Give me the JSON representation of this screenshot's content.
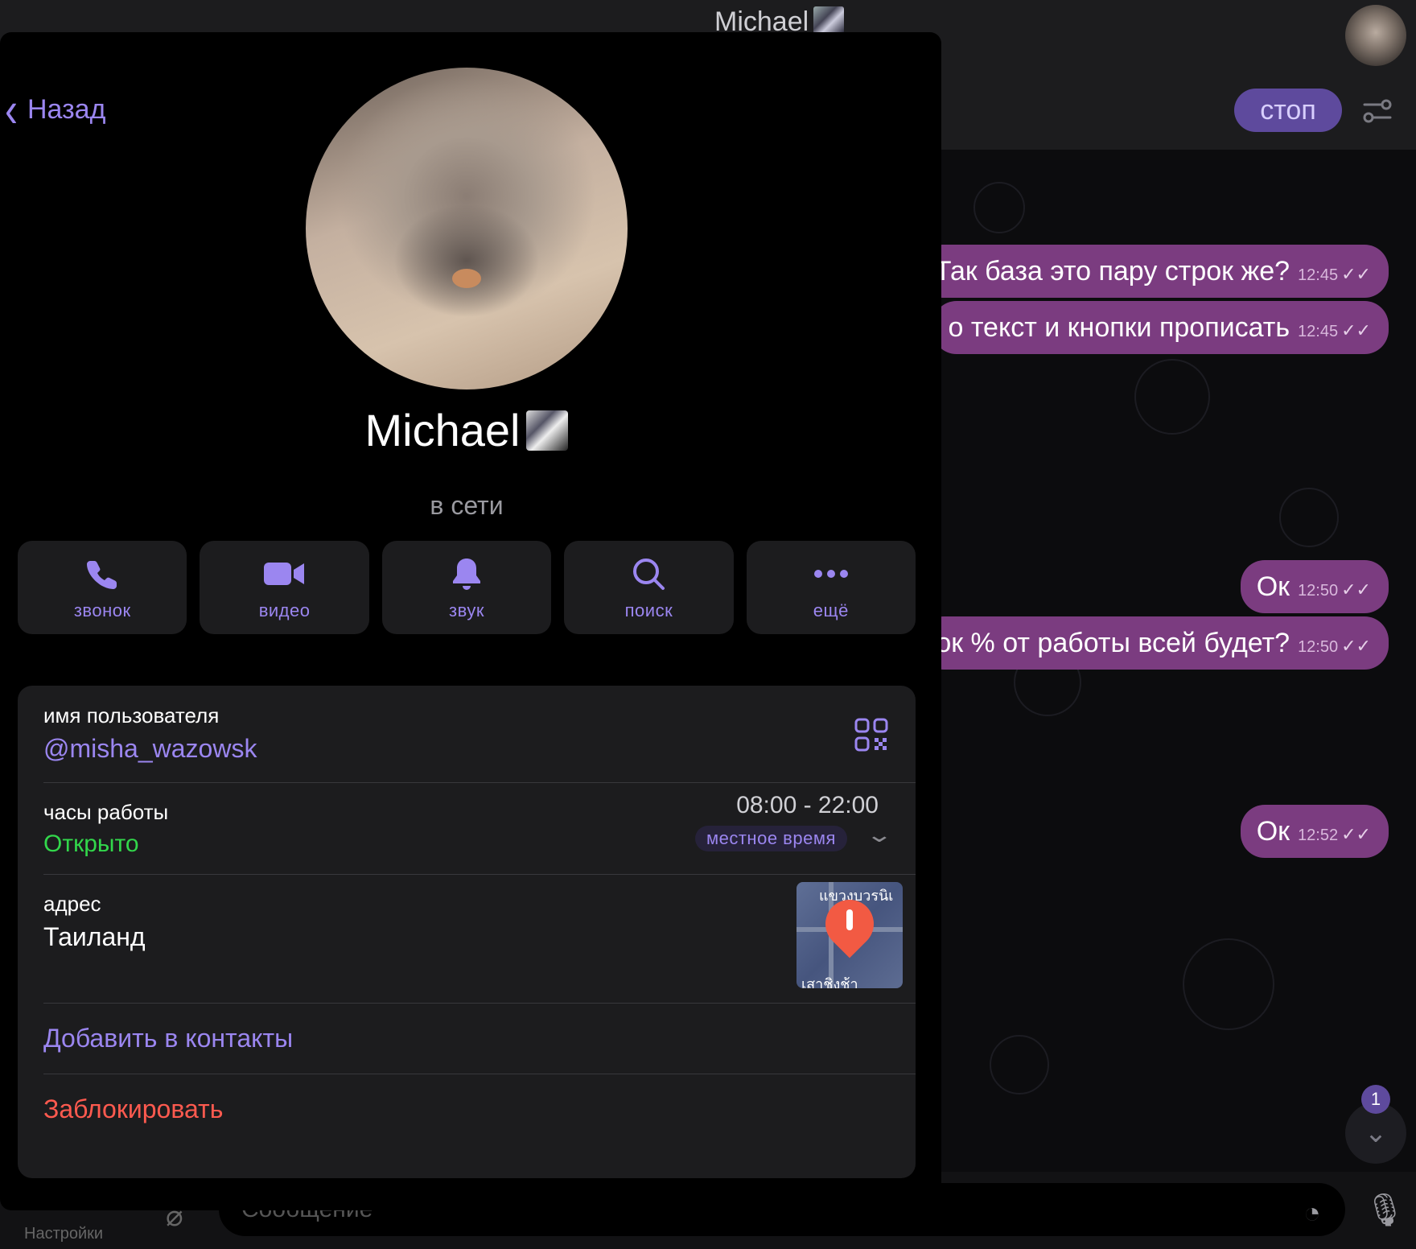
{
  "chat": {
    "header_title": "Michael",
    "stop_label": "стоп",
    "messages": [
      {
        "text": "Так база это пару строк же?",
        "time": "12:45"
      },
      {
        "text": "о текст и кнопки прописать",
        "time": "12:45"
      },
      {
        "text": "Ок",
        "time": "12:50"
      },
      {
        "text": "ок % от работы всей будет?",
        "time": "12:50"
      },
      {
        "text": "Ок",
        "time": "12:52"
      }
    ],
    "ticks": "✓✓",
    "unread_count": "1",
    "input_placeholder": "Сообщение",
    "settings_label": "Настройки"
  },
  "profile": {
    "back_label": "Назад",
    "name": "Michael",
    "status": "в сети",
    "actions": [
      {
        "label": "звонок",
        "icon": "phone-icon"
      },
      {
        "label": "видео",
        "icon": "video-icon"
      },
      {
        "label": "звук",
        "icon": "bell-icon"
      },
      {
        "label": "поиск",
        "icon": "search-icon"
      },
      {
        "label": "ещё",
        "icon": "more-icon"
      }
    ],
    "username_label": "имя пользователя",
    "username": "@misha_wazowsk",
    "hours_label": "часы работы",
    "hours_status": "Открыто",
    "hours_value": "08:00 - 22:00",
    "local_time_label": "местное время",
    "address_label": "адрес",
    "address_value": "Таиланд",
    "map_text_top": "แขวงบวรนิเ",
    "map_text_bottom": "เสาชิงช้า",
    "add_contact_label": "Добавить в контакты",
    "block_label": "Заблокировать"
  },
  "colors": {
    "accent": "#9b86f0",
    "bubble": "#7b3c80",
    "open": "#32d74b",
    "danger": "#ff5a4f"
  }
}
